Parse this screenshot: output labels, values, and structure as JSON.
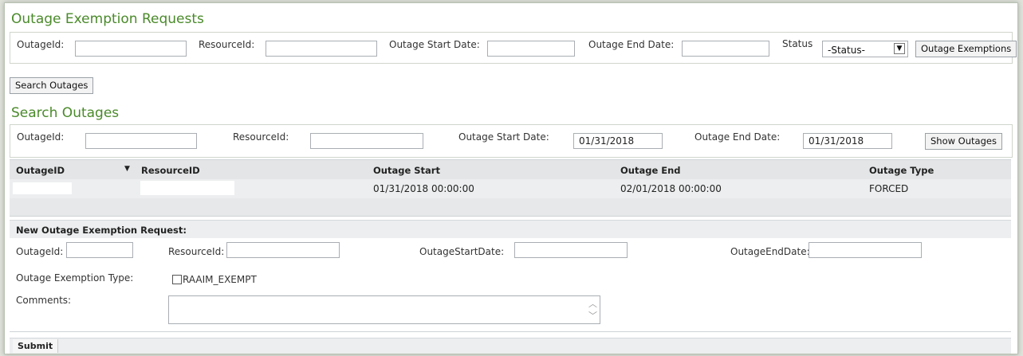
{
  "exemption": {
    "title": "Outage Exemption Requests",
    "fields": {
      "outage_id_label": "OutageId:",
      "resource_id_label": "ResourceId:",
      "start_label": "Outage Start Date:",
      "end_label": "Outage End Date:",
      "status_label": "Status",
      "status_value": "-Status-",
      "outage_exemptions_button": "Outage Exemptions"
    },
    "search_outages_button": "Search Outages"
  },
  "search": {
    "title": "Search Outages",
    "outage_id_label": "OutageId:",
    "resource_id_label": "ResourceId:",
    "start_label": "Outage Start Date:",
    "start_value": "01/31/2018",
    "end_label": "Outage End Date:",
    "end_value": "01/31/2018",
    "show_button": "Show Outages"
  },
  "table": {
    "columns": [
      "OutageID",
      "ResourceID",
      "Outage Start",
      "Outage End",
      "Outage Type"
    ],
    "sort_indicator": "▼",
    "rows": [
      {
        "outage_id": "",
        "resource_id": "",
        "start": "01/31/2018 00:00:00",
        "end": "02/01/2018 00:00:00",
        "type": "FORCED"
      }
    ]
  },
  "new_request": {
    "header": "New Outage Exemption Request:",
    "outage_id_label": "OutageId:",
    "resource_id_label": "ResourceId:",
    "start_label": "OutageStartDate:",
    "end_label": "OutageEndDate:",
    "type_label": "Outage Exemption Type:",
    "type_option": "RAAIM_EXEMPT",
    "comments_label": "Comments:",
    "submit_label": "Submit"
  },
  "colors": {
    "heading_green": "#4a8a2a",
    "table_header_bg": "#e3e5e6",
    "row_bg": "#eceeef"
  }
}
